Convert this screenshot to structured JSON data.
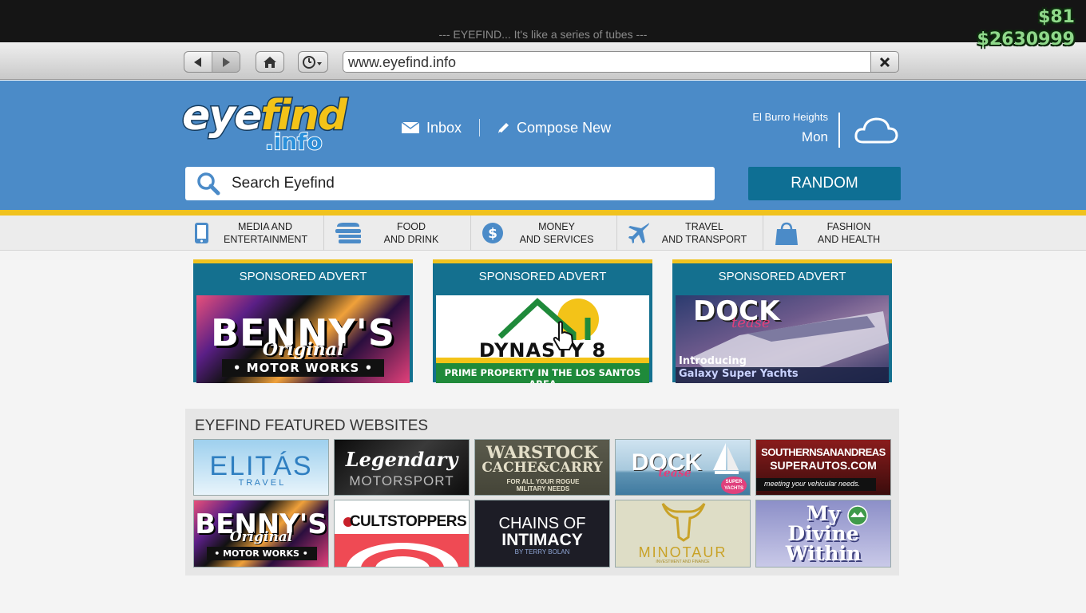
{
  "window": {
    "tagline": "--- EYEFIND... It's like a series of tubes ---"
  },
  "hud": {
    "cash": "$81",
    "bank": "$2630999"
  },
  "toolbar": {
    "url": "www.eyefind.info"
  },
  "header": {
    "logo_eye": "eye",
    "logo_find": "find",
    "logo_info": ".info",
    "inbox_label": "Inbox",
    "compose_label": "Compose New",
    "location": "El Burro Heights",
    "day": "Mon",
    "search_placeholder": "Search Eyefind",
    "random_label": "RANDOM"
  },
  "categories": [
    {
      "line1": "MEDIA AND",
      "line2": "ENTERTAINMENT",
      "icon": "phone-icon"
    },
    {
      "line1": "FOOD",
      "line2": "AND DRINK",
      "icon": "burger-icon"
    },
    {
      "line1": "MONEY",
      "line2": "AND SERVICES",
      "icon": "dollar-icon"
    },
    {
      "line1": "TRAVEL",
      "line2": "AND TRANSPORT",
      "icon": "plane-icon"
    },
    {
      "line1": "FASHION",
      "line2": "AND HEALTH",
      "icon": "shopping-bag-icon"
    }
  ],
  "adverts": [
    {
      "header": "SPONSORED ADVERT",
      "title": "BENNY'S",
      "script": "Original",
      "sub": "• MOTOR WORKS •"
    },
    {
      "header": "SPONSORED ADVERT",
      "title": "DYNASTY 8",
      "sub": "PRIME PROPERTY IN THE LOS SANTOS AREA"
    },
    {
      "header": "SPONSORED ADVERT",
      "title": "DOCK",
      "script": "tease",
      "sub1": "Introducing",
      "sub2": "Galaxy Super Yachts"
    }
  ],
  "featured": {
    "title": "EYEFIND FEATURED WEBSITES",
    "sites": [
      {
        "title": "ELITÁS",
        "sub": "T R A V E L"
      },
      {
        "title": "Legendary",
        "sub": "MOTORSPORT"
      },
      {
        "title": "WARSTOCK",
        "sub": "CACHE&CARRY",
        "small": "FOR ALL YOUR ROGUE MILITARY NEEDS"
      },
      {
        "title": "DOCK",
        "script": "tease",
        "badge": "SUPER YACHTS"
      },
      {
        "title": "SOUTHERNSANANDREAS",
        "sub": "SUPERAUTOS.COM",
        "small": "meeting your vehicular needs."
      },
      {
        "title": "BENNY'S",
        "script": "Original",
        "sub": "• MOTOR WORKS •"
      },
      {
        "title": "CULTSTOPPERS"
      },
      {
        "title": "CHAINS OF",
        "sub": "INTIMACY",
        "small": "BY TERRY BOLAN"
      },
      {
        "title": "MINOTAUR",
        "small": "INVESTMENT AND FINANCE"
      },
      {
        "title": "My",
        "sub": "Divine",
        "small": "Within"
      }
    ]
  }
}
